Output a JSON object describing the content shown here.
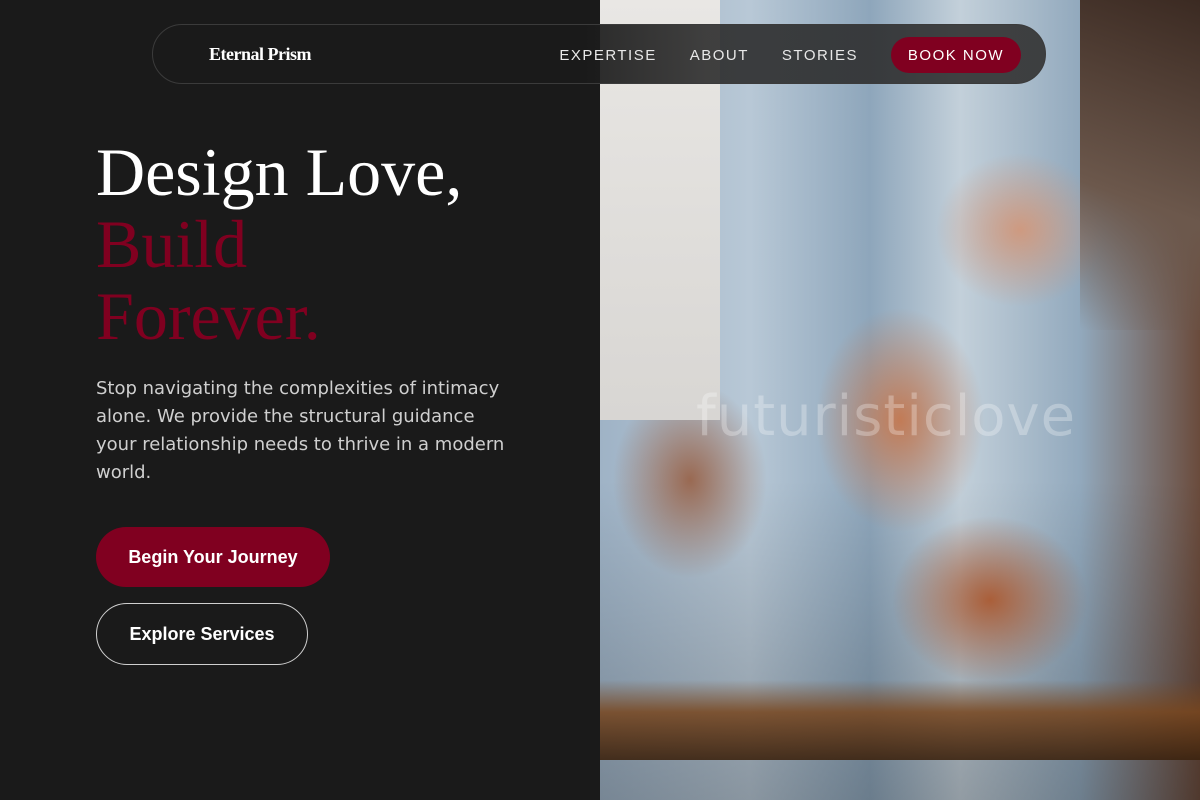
{
  "nav": {
    "brand": "Eternal Prism",
    "links": [
      "EXPERTISE",
      "ABOUT",
      "STORIES"
    ],
    "cta": "BOOK NOW"
  },
  "hero": {
    "headline_line1": "Design Love,",
    "headline_line2": "Build",
    "headline_line3": "Forever.",
    "description": "Stop navigating the complexities of intimacy alone. We provide the structural guidance your relationship needs to thrive in a modern world.",
    "primary_cta": "Begin Your Journey",
    "secondary_cta": "Explore Services"
  },
  "photo": {
    "watermark": "futuristiclove"
  },
  "colors": {
    "background": "#1a1a1a",
    "accent": "#800020",
    "text": "#ffffff",
    "muted_text": "#cfcfcf"
  }
}
